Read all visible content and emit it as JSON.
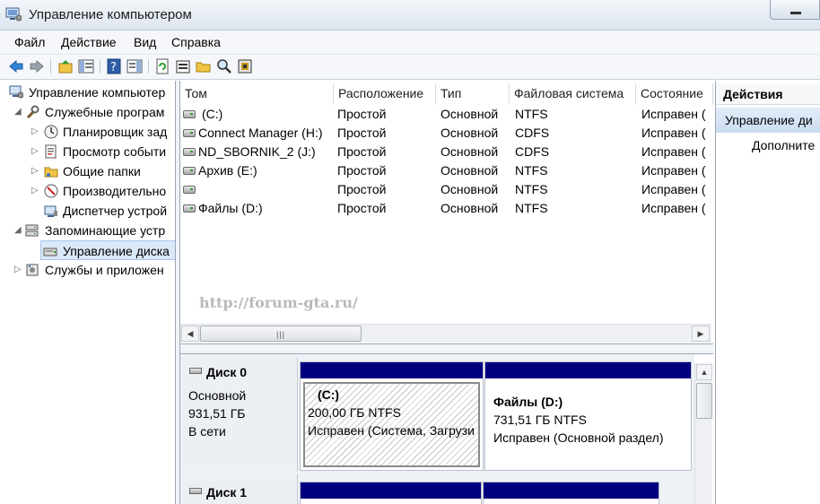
{
  "window": {
    "title": "Управление компьютером",
    "app_icon": "computer-management-icon"
  },
  "menu": [
    "Файл",
    "Действие",
    "Вид",
    "Справка"
  ],
  "toolbar": {
    "icons": [
      "back-arrow-icon",
      "forward-arrow-icon",
      "up-folder-icon",
      "show-hide-tree-icon",
      "help-icon",
      "show-hide-action-pane-icon",
      "refresh-icon",
      "properties-icon",
      "open-folder-icon",
      "search-disk-icon",
      "disk-properties-icon"
    ]
  },
  "tree": {
    "items": [
      {
        "label": "Управление компьютер",
        "icon": "computer-management-icon",
        "level": 0,
        "arrow": ""
      },
      {
        "label": "Служебные програм",
        "icon": "tools-icon",
        "level": 1,
        "arrow": "◢"
      },
      {
        "label": "Планировщик зад",
        "icon": "clock-icon",
        "level": 2,
        "arrow": "▷"
      },
      {
        "label": "Просмотр событи",
        "icon": "event-viewer-icon",
        "level": 2,
        "arrow": "▷"
      },
      {
        "label": "Общие папки",
        "icon": "shared-folder-icon",
        "level": 2,
        "arrow": "▷"
      },
      {
        "label": "Производительно",
        "icon": "performance-icon",
        "level": 2,
        "arrow": "▷"
      },
      {
        "label": "Диспетчер устрой",
        "icon": "device-manager-icon",
        "level": 2,
        "arrow": ""
      },
      {
        "label": "Запоминающие устр",
        "icon": "storage-icon",
        "level": 1,
        "arrow": "◢"
      },
      {
        "label": "Управление диска",
        "icon": "disk-management-icon",
        "level": 2,
        "arrow": "",
        "selected": true
      },
      {
        "label": "Службы и приложен",
        "icon": "services-icon",
        "level": 1,
        "arrow": "▷"
      }
    ]
  },
  "volumes": {
    "columns": [
      "Том",
      "Расположение",
      "Тип",
      "Файловая система",
      "Состояние"
    ],
    "rows": [
      {
        "name": "(C:)",
        "location": "Простой",
        "type": "Основной",
        "fs": "NTFS",
        "status": "Исправен ("
      },
      {
        "name": "Connect Manager (H:)",
        "location": "Простой",
        "type": "Основной",
        "fs": "CDFS",
        "status": "Исправен ("
      },
      {
        "name": "ND_SBORNIK_2 (J:)",
        "location": "Простой",
        "type": "Основной",
        "fs": "CDFS",
        "status": "Исправен ("
      },
      {
        "name": "Архив (E:)",
        "location": "Простой",
        "type": "Основной",
        "fs": "NTFS",
        "status": "Исправен ("
      },
      {
        "name": "",
        "location": "Простой",
        "type": "Основной",
        "fs": "NTFS",
        "status": "Исправен ("
      },
      {
        "name": "Файлы (D:)",
        "location": "Простой",
        "type": "Основной",
        "fs": "NTFS",
        "status": "Исправен ("
      }
    ],
    "watermark": "http://forum-gta.ru/"
  },
  "disks": [
    {
      "name": "Диск 0",
      "kind": "Основной",
      "size": "931,51 ГБ",
      "state": "В сети",
      "partitions": [
        {
          "name": "(C:)",
          "size_fs": "200,00 ГБ NTFS",
          "status": "Исправен (Система, Загрузи"
        },
        {
          "name": "Файлы  (D:)",
          "size_fs": "731,51 ГБ NTFS",
          "status": "Исправен (Основной раздел)"
        }
      ]
    },
    {
      "name": "Диск 1"
    }
  ],
  "actions": {
    "header": "Действия",
    "section": "Управление ди",
    "more": "Дополните"
  }
}
